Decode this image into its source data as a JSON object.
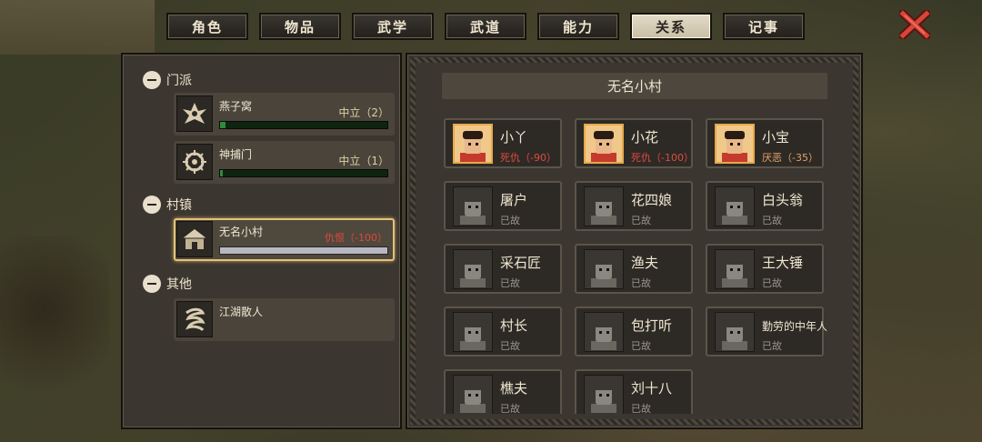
{
  "tabs": [
    {
      "label": "角色"
    },
    {
      "label": "物品"
    },
    {
      "label": "武学"
    },
    {
      "label": "武道"
    },
    {
      "label": "能力"
    },
    {
      "label": "关系",
      "active": true
    },
    {
      "label": "记事"
    }
  ],
  "sections": {
    "sect": "门派",
    "village": "村镇",
    "other": "其他"
  },
  "factions": [
    {
      "name": "燕子窝",
      "status": "中立（2）",
      "level": 0.02,
      "icon": "swallow-crest-icon"
    },
    {
      "name": "神捕门",
      "status": "中立（1）",
      "level": 0.01,
      "icon": "constable-crest-icon"
    },
    {
      "name": "无名小村",
      "status": "仇恨（-100）",
      "level": 1.0,
      "icon": "village-hut-icon"
    },
    {
      "name": "江湖散人",
      "icon": "wanderer-scroll-icon"
    }
  ],
  "village_panel": {
    "title": "无名小村",
    "npcs": [
      {
        "name": "小丫",
        "status": "死仇（-90）",
        "tone": "red",
        "alive": true
      },
      {
        "name": "小花",
        "status": "死仇（-100）",
        "tone": "red",
        "alive": true
      },
      {
        "name": "小宝",
        "status": "厌恶（-35）",
        "tone": "orange",
        "alive": true
      },
      {
        "name": "屠户",
        "status": "已故",
        "tone": "gray",
        "alive": false
      },
      {
        "name": "花四娘",
        "status": "已故",
        "tone": "gray",
        "alive": false
      },
      {
        "name": "白头翁",
        "status": "已故",
        "tone": "gray",
        "alive": false
      },
      {
        "name": "采石匠",
        "status": "已故",
        "tone": "gray",
        "alive": false
      },
      {
        "name": "渔夫",
        "status": "已故",
        "tone": "gray",
        "alive": false
      },
      {
        "name": "王大锤",
        "status": "已故",
        "tone": "gray",
        "alive": false
      },
      {
        "name": "村长",
        "status": "已故",
        "tone": "gray",
        "alive": false
      },
      {
        "name": "包打听",
        "status": "已故",
        "tone": "gray",
        "alive": false
      },
      {
        "name": "勤劳的中年人",
        "status": "已故",
        "tone": "gray",
        "alive": false
      },
      {
        "name": "樵夫",
        "status": "已故",
        "tone": "gray",
        "alive": false
      },
      {
        "name": "刘十八",
        "status": "已故",
        "tone": "gray",
        "alive": false
      }
    ]
  },
  "colors": {
    "hostile": "#e24a3c",
    "dislike": "#e4a064",
    "neutral": "#dcd0a0",
    "bar_green": "#2f8a3a",
    "selected_border": "#e2c27a"
  }
}
